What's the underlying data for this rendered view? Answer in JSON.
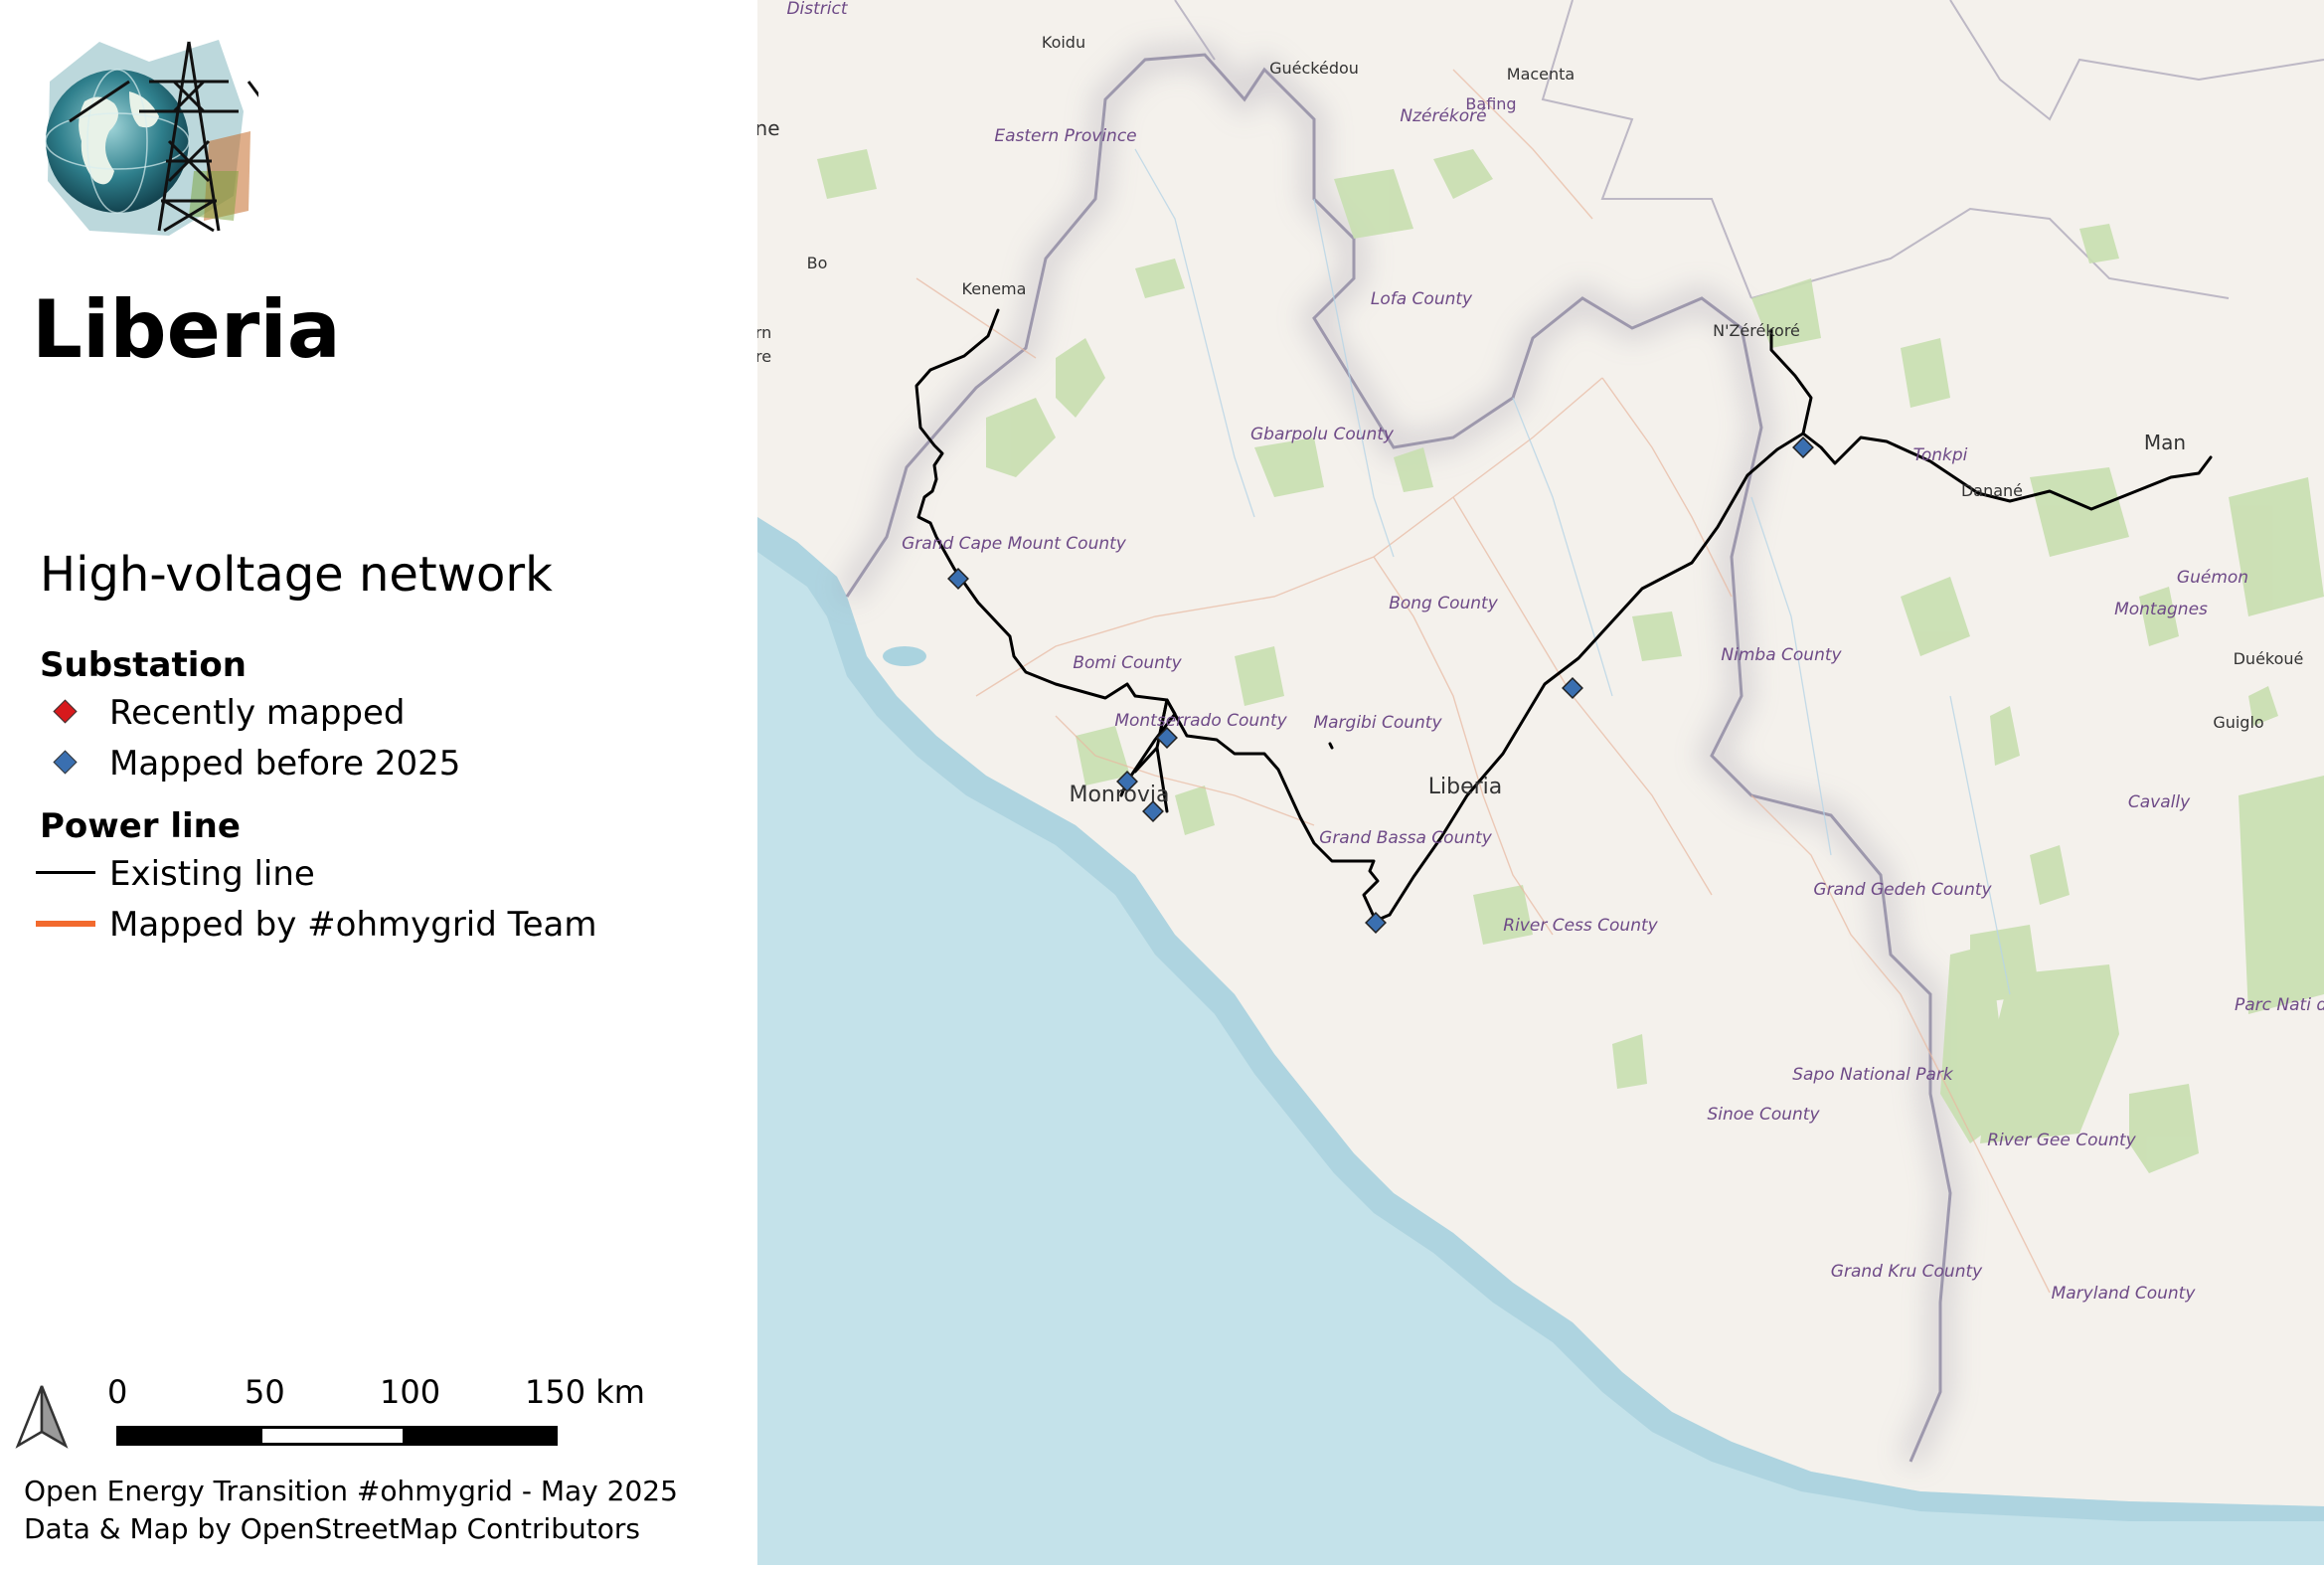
{
  "title": "Liberia",
  "legend": {
    "title": "High-voltage network",
    "substation_header": "Substation",
    "recently_mapped": "Recently mapped",
    "mapped_before": "Mapped before 2025",
    "power_line_header": "Power line",
    "existing_line": "Existing line",
    "mapped_by_team": "Mapped by #ohmygrid Team"
  },
  "colors": {
    "recently_mapped": "#d7191c",
    "mapped_before": "#3a6fb0",
    "existing_line": "#000000",
    "team_line": "#f26a2e",
    "sea": "#aad3df",
    "land": "#f2efe9",
    "park": "#c8dfb0"
  },
  "scale": {
    "labels": [
      "0",
      "50",
      "100",
      "150 km"
    ]
  },
  "north_arrow_icon": "north-arrow-icon",
  "credits": {
    "line1": "Open Energy Transition #ohmygrid - May 2025",
    "line2": "Data & Map by OpenStreetMap Contributors"
  },
  "map_labels": {
    "district": "District",
    "koidu": "Koidu",
    "gueckedou": "Guéckédou",
    "macenta": "Macenta",
    "nzerekore_region": "Nzérékoré",
    "bafing": "Bafing",
    "ne": "ne",
    "eastern_province": "Eastern Province",
    "bo": "Bo",
    "kenema": "Kenema",
    "rn": "rn",
    "re": "re",
    "lofa": "Lofa County",
    "gbarpolu": "Gbarpolu County",
    "nzerekore_city": "N'Zérékoré",
    "man": "Man",
    "tonkpi": "Tonkpi",
    "danane": "Danané",
    "guemon": "Guémon",
    "montagnes": "Montagnes",
    "duekoue": "Duékoué",
    "grand_cape_mount": "Grand Cape Mount County",
    "bong": "Bong County",
    "nimba": "Nimba County",
    "bomi": "Bomi County",
    "montserrado": "Montserrado County",
    "margibi": "Margibi County",
    "liberia": "Liberia",
    "guiglo": "Guiglo",
    "monrovia": "Monrovia",
    "cavally": "Cavally",
    "grand_bassa": "Grand Bassa County",
    "grand_gedeh": "Grand Gedeh County",
    "river_cess": "River Cess County",
    "parc_national": "Parc Nati de Ta",
    "sapo": "Sapo National Park",
    "sinoe": "Sinoe County",
    "river_gee": "River Gee County",
    "grand_kru": "Grand Kru County",
    "maryland": "Maryland County"
  }
}
